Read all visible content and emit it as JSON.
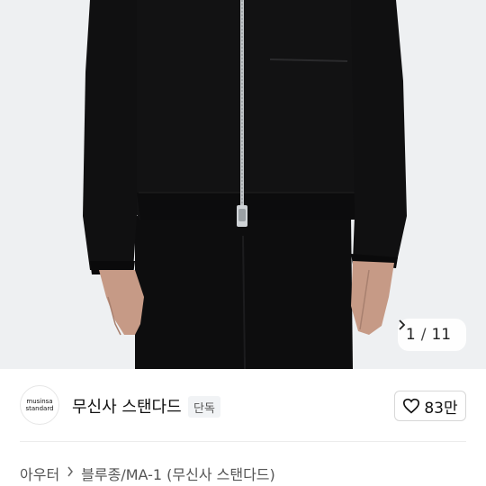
{
  "gallery": {
    "current": "1",
    "separator": "/",
    "total": "11",
    "next_icon": "chevron-right-icon",
    "bg_color": "#eef0f2",
    "garment_color": "#0f0f10"
  },
  "brand": {
    "logo_line1": "musinsa",
    "logo_line2": "standard",
    "name": "무신사 스탠다드",
    "badge": "단독",
    "like_icon": "heart-icon",
    "like_count": "83만"
  },
  "breadcrumb": {
    "items": [
      "아우터",
      "블루종/MA-1 (무신사 스탠다드)"
    ],
    "separator_icon": "chevron-right-icon"
  }
}
